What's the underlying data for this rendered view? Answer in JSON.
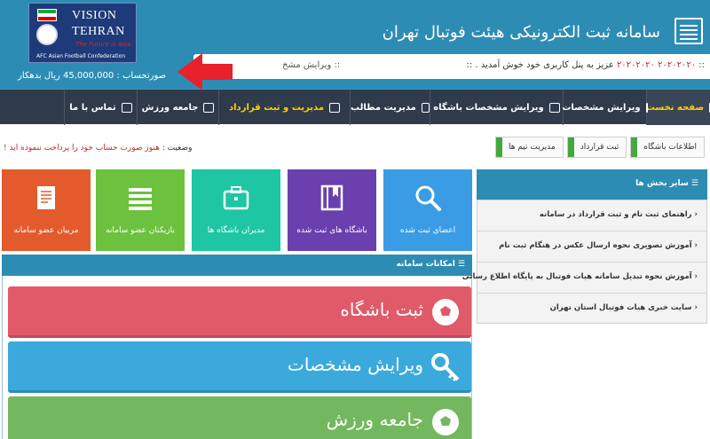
{
  "header": {
    "title": "سامانه ثبت الکترونیکی هیئت فوتبال تهران",
    "logo": {
      "line1": "VISION",
      "line2": "TEHRAN",
      "slogan": "The Future is Asia",
      "org": "AFC Asian Football Confederation"
    },
    "ticker": {
      "text_prefix": "::",
      "numbers": "۲۰۲۰۲۰۲۰ ۲۰۲۰۲۰۲۰",
      "text": "عزیز به پنل کاربری خود خوش آمدید .",
      "suffix": "::",
      "left_text": ":: ویرایش مشخ"
    },
    "invoice": "صورتحساب : 45,000,000 ریال بدهکار"
  },
  "nav": {
    "items": [
      {
        "label": "صفحه نخست",
        "icon": "home-icon"
      },
      {
        "label": "ویرایش مشخصات",
        "icon": "edit-icon"
      },
      {
        "label": "ویرایش مشخصات باشگاه",
        "icon": "flag-icon"
      },
      {
        "label": "مدیریت مطالب",
        "icon": "book-icon"
      },
      {
        "label": "مدیریت و ثبت قرارداد",
        "icon": "inbox-icon"
      },
      {
        "label": "جامعه ورزش",
        "icon": "users-icon"
      },
      {
        "label": "تماس با ما",
        "icon": "flag-icon"
      }
    ]
  },
  "status": {
    "label": "وضعیت :",
    "message": "هنوز صورت حساب خود را پرداخت ننموده اید !"
  },
  "breadcrumb": [
    "اطلاعات باشگاه",
    "ثبت قرارداد",
    "مدیریت تیم ها"
  ],
  "tiles": [
    {
      "label": "اعضای ثبت شده",
      "color": "#3b9ce6",
      "icon": "search-icon"
    },
    {
      "label": "باشگاه های ثبت شده",
      "color": "#6a3fae",
      "icon": "book-icon"
    },
    {
      "label": "مدیران باشگاه ها",
      "color": "#1ec6a3",
      "icon": "briefcase-icon"
    },
    {
      "label": "بازیکنان عضو سامانه",
      "color": "#6cc13e",
      "icon": "list-icon"
    },
    {
      "label": "مربیان عضو سامانه",
      "color": "#e35a2c",
      "icon": "document-icon"
    }
  ],
  "features": {
    "title": "امکانات سامانه",
    "buttons": [
      {
        "label": "ثبت باشگاه",
        "color": "#e05a6a",
        "icon": "ball-icon"
      },
      {
        "label": "ویرایش مشخصات",
        "color": "#3ba9dc",
        "icon": "key-icon"
      },
      {
        "label": "جامعه ورزش",
        "color": "#73b85e",
        "icon": "ball-icon"
      }
    ]
  },
  "sidebar": {
    "title": "سایر بخش ها",
    "items": [
      {
        "label": "راهنمای ثبت نام و ثبت قرارداد در سامانه"
      },
      {
        "label": "آموزش تصویری نحوه ارسال عکس در هنگام ثبت نام"
      },
      {
        "label": "آموزش نحوه تبدیل سامانه هیات فوتبال به پایگاه اطلاع رسانی"
      },
      {
        "label": "سایت خبری هیات فوتبال استان تهران"
      }
    ]
  },
  "colors": {
    "header_bg": "#2d8cb4",
    "nav_bg": "#2f3b4a",
    "nav_active_text": "#ffd200",
    "alert_red": "#c62828",
    "crumb_green": "#44a83c"
  }
}
